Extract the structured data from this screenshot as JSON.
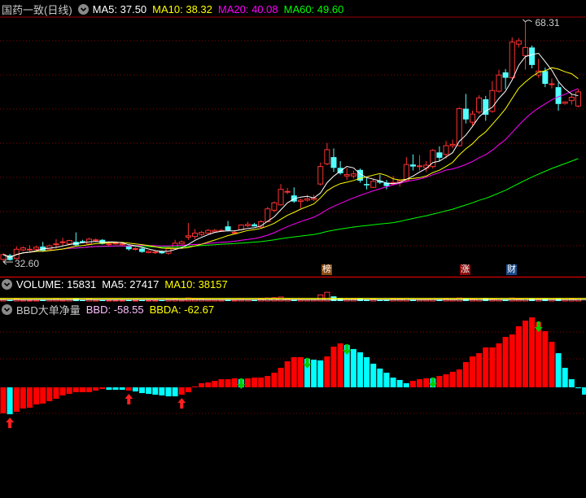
{
  "main_header": {
    "title": "国药一致(日线)",
    "ma5": "MA5: 37.50",
    "ma10": "MA10: 38.32",
    "ma20": "MA20: 40.08",
    "ma60": "MA60: 49.60"
  },
  "volume_header": {
    "title": "VOLUME: 15831",
    "ma5": "MA5: 27417",
    "ma10": "MA10: 38157"
  },
  "bbd_header": {
    "title": "BBD大单净量",
    "bbd": "BBD: -58.55",
    "bbda": "BBDA: -62.67"
  },
  "markers": [
    {
      "label": "榜",
      "color": "#8b4a10"
    },
    {
      "label": "涨",
      "color": "#8b0a0a"
    },
    {
      "label": "财",
      "color": "#1a4a8a"
    }
  ],
  "colors": {
    "up": "#ff3232",
    "down": "#54ffff",
    "ma5": "#ffffff",
    "ma10": "#ffff00",
    "ma20": "#ff00ff",
    "ma60": "#00ff00",
    "grid": "#8b0000",
    "bbd_label": "#ffc0ff"
  },
  "chart_data": [
    {
      "type": "candlestick",
      "title": "国药一致(日线)",
      "high_label": "68.31",
      "low_label": "32.60",
      "ohlc": [
        [
          33.0,
          33.9,
          32.6,
          33.7
        ],
        [
          33.6,
          33.8,
          32.8,
          32.9
        ],
        [
          33.1,
          34.9,
          33.0,
          34.5
        ],
        [
          34.4,
          34.9,
          34.2,
          34.7
        ],
        [
          34.5,
          35.1,
          34.1,
          34.5
        ],
        [
          34.5,
          35.0,
          34.3,
          34.8
        ],
        [
          34.9,
          35.6,
          34.1,
          34.3
        ],
        [
          34.5,
          35.2,
          34.3,
          35.0
        ],
        [
          35.3,
          36.0,
          34.6,
          35.3
        ],
        [
          35.5,
          36.2,
          35.0,
          35.6
        ],
        [
          35.3,
          35.9,
          35.1,
          35.8
        ],
        [
          35.6,
          37.0,
          35.0,
          35.1
        ],
        [
          35.7,
          35.9,
          35.4,
          35.5
        ],
        [
          35.3,
          36.2,
          35.2,
          36.0
        ],
        [
          35.8,
          36.1,
          35.6,
          35.9
        ],
        [
          35.9,
          36.0,
          35.2,
          35.3
        ],
        [
          35.3,
          35.6,
          35.0,
          35.3
        ],
        [
          35.3,
          35.6,
          35.2,
          35.4
        ],
        [
          35.2,
          35.4,
          35.0,
          35.3
        ],
        [
          35.0,
          35.2,
          34.3,
          34.5
        ],
        [
          34.5,
          34.8,
          34.3,
          34.6
        ],
        [
          34.6,
          34.7,
          34.0,
          34.1
        ],
        [
          34.0,
          34.3,
          33.9,
          34.2
        ],
        [
          34.1,
          34.4,
          33.8,
          34.1
        ],
        [
          34.2,
          34.3,
          33.8,
          33.9
        ],
        [
          33.9,
          34.9,
          33.7,
          34.7
        ],
        [
          34.6,
          35.9,
          34.5,
          35.4
        ],
        [
          35.3,
          35.8,
          35.2,
          35.6
        ],
        [
          36.3,
          38.4,
          35.9,
          36.5
        ],
        [
          36.4,
          37.5,
          36.0,
          36.9
        ],
        [
          36.7,
          37.2,
          36.5,
          37.0
        ],
        [
          36.9,
          37.5,
          36.8,
          37.3
        ],
        [
          37.1,
          37.5,
          37.0,
          37.3
        ],
        [
          37.3,
          37.5,
          37.1,
          37.3
        ],
        [
          37.9,
          38.7,
          37.2,
          37.3
        ],
        [
          37.0,
          37.3,
          36.8,
          37.0
        ],
        [
          37.4,
          38.2,
          37.3,
          38.1
        ],
        [
          38.0,
          38.6,
          37.8,
          38.2
        ],
        [
          38.2,
          38.4,
          37.9,
          37.9
        ],
        [
          37.8,
          38.8,
          37.6,
          38.6
        ],
        [
          38.6,
          40.8,
          38.5,
          40.5
        ],
        [
          40.3,
          41.6,
          40.0,
          41.4
        ],
        [
          41.1,
          44.2,
          41.0,
          43.4
        ],
        [
          43.1,
          43.6,
          42.7,
          43.1
        ],
        [
          42.5,
          43.7,
          41.4,
          41.6
        ],
        [
          41.6,
          42.0,
          40.6,
          41.8
        ],
        [
          41.8,
          42.6,
          41.6,
          42.0
        ],
        [
          41.9,
          42.6,
          41.7,
          42.1
        ],
        [
          44.2,
          47.4,
          44.0,
          46.8
        ],
        [
          47.2,
          50.3,
          47.0,
          49.3
        ],
        [
          48.2,
          49.5,
          46.0,
          46.6
        ],
        [
          46.6,
          47.6,
          45.6,
          45.8
        ],
        [
          45.4,
          46.6,
          44.8,
          45.6
        ],
        [
          45.4,
          46.2,
          45.0,
          45.7
        ],
        [
          46.3,
          46.5,
          44.4,
          44.7
        ],
        [
          44.2,
          45.3,
          43.4,
          44.0
        ],
        [
          43.7,
          45.0,
          43.6,
          44.6
        ],
        [
          44.7,
          45.6,
          44.2,
          44.4
        ],
        [
          44.4,
          44.8,
          43.4,
          43.9
        ],
        [
          44.2,
          45.4,
          44.0,
          44.4
        ],
        [
          44.5,
          44.8,
          43.8,
          44.7
        ],
        [
          44.7,
          48.2,
          44.5,
          47.1
        ],
        [
          47.1,
          48.6,
          46.2,
          46.8
        ],
        [
          46.9,
          48.5,
          46.2,
          46.9
        ],
        [
          46.6,
          47.6,
          46.0,
          47.0
        ],
        [
          46.8,
          49.4,
          46.5,
          49.2
        ],
        [
          48.9,
          49.8,
          47.6,
          48.1
        ],
        [
          48.6,
          50.6,
          48.0,
          49.9
        ],
        [
          49.9,
          50.8,
          49.5,
          50.1
        ],
        [
          49.9,
          55.6,
          49.8,
          55.4
        ],
        [
          55.4,
          57.6,
          53.2,
          53.8
        ],
        [
          53.4,
          55.1,
          52.9,
          54.6
        ],
        [
          54.9,
          57.4,
          54.6,
          57.0
        ],
        [
          56.8,
          57.3,
          53.6,
          54.5
        ],
        [
          55.0,
          59.5,
          54.8,
          58.1
        ],
        [
          58.0,
          61.2,
          57.8,
          60.4
        ],
        [
          60.8,
          61.3,
          58.3,
          60.0
        ],
        [
          60.0,
          66.0,
          59.8,
          65.3
        ],
        [
          65.0,
          65.9,
          64.5,
          65.5
        ],
        [
          63.3,
          68.31,
          61.2,
          64.5
        ],
        [
          64.5,
          64.8,
          61.4,
          61.9
        ],
        [
          60.4,
          62.8,
          60.0,
          61.0
        ],
        [
          61.0,
          61.5,
          58.6,
          59.1
        ],
        [
          59.1,
          59.9,
          58.4,
          59.1
        ],
        [
          58.6,
          59.3,
          55.1,
          56.1
        ],
        [
          56.2,
          56.5,
          56.0,
          56.4
        ],
        [
          56.6,
          57.6,
          56.0,
          57.1
        ],
        [
          55.8,
          58.3,
          55.6,
          57.9
        ]
      ],
      "ma_periods": [
        5,
        10,
        20,
        60
      ],
      "marker_candle_index": [
        49,
        69,
        77
      ],
      "y_range": [
        32.6,
        68.31
      ]
    },
    {
      "type": "bar",
      "title": "VOLUME",
      "values": [
        20000,
        15000,
        25000,
        15000,
        12000,
        15000,
        20000,
        18000,
        22000,
        15000,
        20000,
        30000,
        15000,
        25000,
        15000,
        15000,
        12000,
        12000,
        12000,
        15000,
        12000,
        15000,
        10000,
        10000,
        12000,
        20000,
        25000,
        15000,
        45000,
        30000,
        25000,
        20000,
        18000,
        15000,
        25000,
        15000,
        20000,
        18000,
        15000,
        25000,
        45000,
        50000,
        60000,
        30000,
        25000,
        20000,
        18000,
        18000,
        90000,
        130000,
        70000,
        45000,
        30000,
        25000,
        35000,
        25000,
        30000,
        20000,
        20000,
        25000,
        25000,
        40000,
        25000,
        20000,
        20000,
        35000,
        25000,
        25000,
        20000,
        45000,
        35000,
        25000,
        35000,
        45000,
        30000,
        35000,
        25000,
        45000,
        30000,
        40000,
        35000,
        25000,
        35000,
        20000,
        40000,
        20000,
        30000,
        35000
      ],
      "ma10_level": 38157
    },
    {
      "type": "bar",
      "title": "BBD大单净量",
      "values": [
        -208,
        -215,
        -195,
        -169,
        -163,
        -137,
        -130,
        -111,
        -91,
        -65,
        -52,
        -39,
        -39,
        -39,
        -26,
        -13,
        -20,
        -20,
        -20,
        -26,
        -33,
        -46,
        -52,
        -59,
        -65,
        -72,
        -72,
        -59,
        -39,
        7,
        33,
        39,
        52,
        65,
        65,
        72,
        65,
        72,
        78,
        78,
        91,
        117,
        156,
        208,
        241,
        241,
        228,
        221,
        215,
        247,
        325,
        351,
        338,
        306,
        280,
        241,
        189,
        150,
        117,
        78,
        59,
        33,
        52,
        65,
        72,
        72,
        91,
        104,
        124,
        143,
        202,
        247,
        273,
        319,
        319,
        351,
        403,
        423,
        488,
        533,
        559,
        520,
        449,
        364,
        273,
        156,
        65,
        -7,
        -58.55
      ],
      "colors": "rcrrrrrrrrrrrrrrcccrcccccccrrrrrrrrrcrrrrrrrrrcccrrrccccccccccrrrcrrrrrrrrrrrrrrrrrrccccccccc",
      "buy_signals": [
        1,
        19,
        27
      ],
      "sell_signals": [
        36,
        46,
        52,
        65,
        81
      ]
    }
  ]
}
